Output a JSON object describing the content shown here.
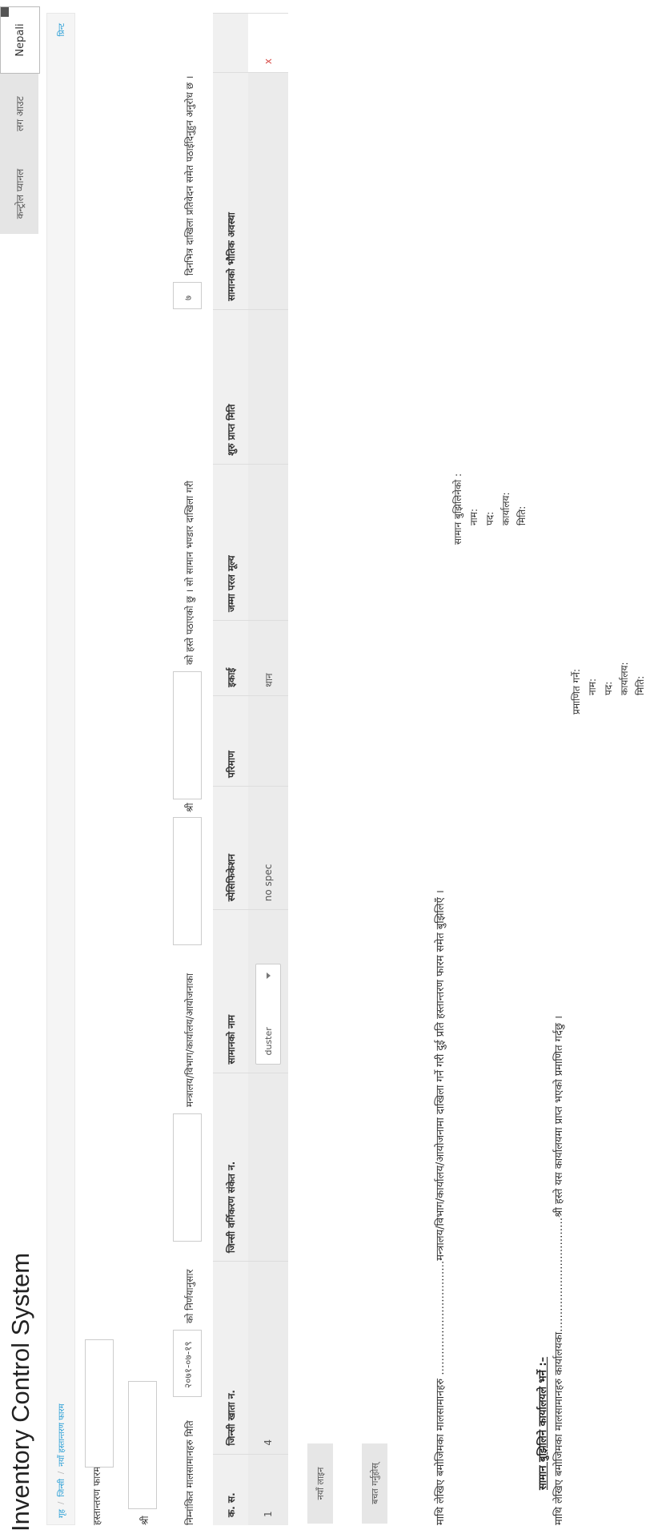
{
  "app": {
    "title": "Inventory Control System"
  },
  "nav": {
    "control_panel": "कन्ट्रोल प्यानल",
    "logout": "लग आउट",
    "language": "Nepali"
  },
  "breadcrumb": {
    "home": "गृह",
    "store": "जिन्सी",
    "current": "नयाँ हस्तान्तरण फारम",
    "print": "प्रिन्ट"
  },
  "form": {
    "form_no_label": "हस्तान्तरण फारम न.",
    "shri": "श्री",
    "intro_prefix": "निम्नांकित मालसामानहरु मिति",
    "date_value": "२०७१-०७-१९",
    "decision_label": "को निर्णयानुसार",
    "ministry_label": "मन्त्रालय/विभाग/कार्यालय/आयोजनाका",
    "shri2": "श्री",
    "sent_label": "को हस्ते पठाएको छु । सो सामान भण्डार दाखिला गरी",
    "days_value": "७",
    "days_suffix": "दिनभित्र दाखिला प्रतिवेदन समेत पठाईदिनुहुन अनुरोध छ ।"
  },
  "table": {
    "headers": [
      "क. स.",
      "जिन्सी खाता न.",
      "जिन्सी वर्गिकरण संकेत न.",
      "सामानको नाम",
      "स्पेसिफिकेशन",
      "परिमाण",
      "इकाई",
      "जम्मा परल मूल्य",
      "शुरु प्राप्त मिति",
      "सामानको भौतिक अवस्था"
    ],
    "rows": [
      {
        "sn": "1",
        "ledger": "4",
        "code": "",
        "name": "duster",
        "spec": "no spec",
        "qty": "",
        "unit": "थान",
        "value": "",
        "date": "",
        "condition": "",
        "delete": "x"
      }
    ]
  },
  "buttons": {
    "new_row": "नयाँ लाइन",
    "save": "बचत गर्नुहोस्"
  },
  "bottom": {
    "para1": "माथि लेखिए बमोजिमका मालसामानहरु ……………………………मन्त्रालय/विभाग/कार्यालय/आयोजनामा दाखिला गर्ने गरी दुई प्रति हस्तान्तरण फारम समेत बुझिलिएँ ।",
    "recv_title": "सामान बुझिलिनेको :",
    "name": "नाम:",
    "post": "पद:",
    "office": "कार्यालय:",
    "date": "मिति:",
    "heading": "सामान बुझिलिने कार्यालयले भर्ने :–",
    "para2": "माथि लेखिए बमोजिमका मालसामानहरु कार्यालयका……………………………श्री हस्ते यस कार्यालयमा प्राप्त भएको प्रमाणित गर्दछु ।",
    "cert_title": "प्रमाणित गर्ने:"
  }
}
